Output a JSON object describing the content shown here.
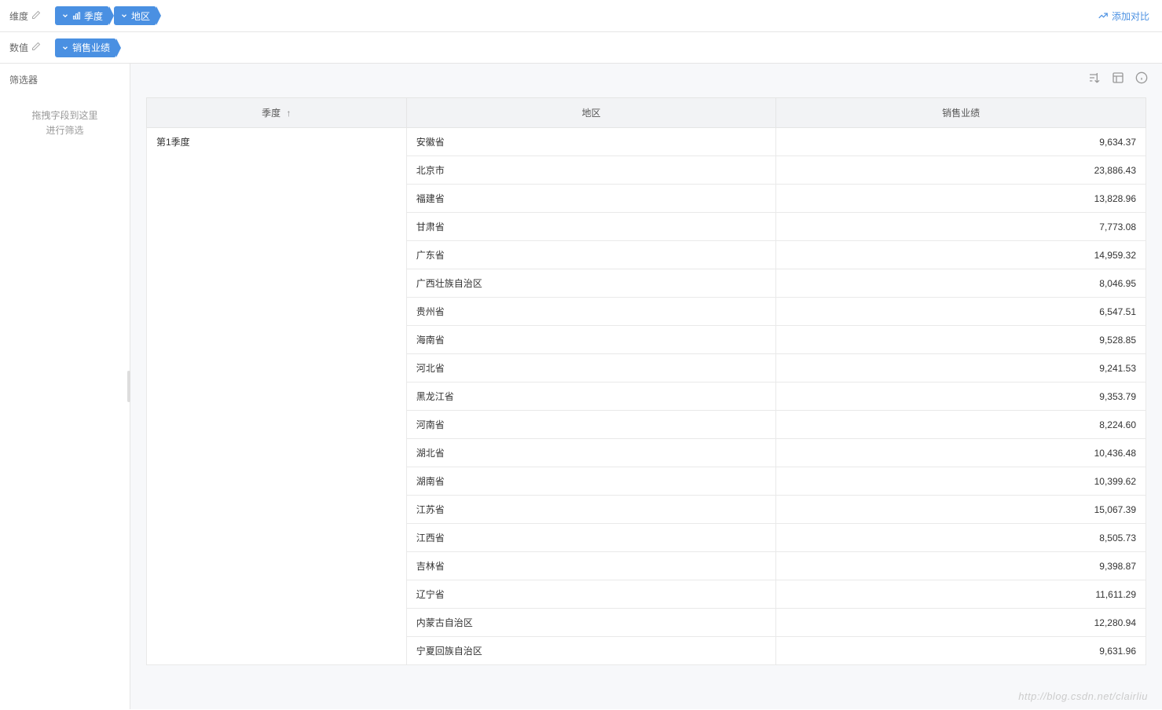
{
  "topbar": {
    "dimension_label": "维度",
    "value_label": "数值",
    "pills_dim": [
      {
        "label": "季度",
        "has_icon": true
      },
      {
        "label": "地区",
        "has_icon": false
      }
    ],
    "pills_val": [
      {
        "label": "销售业绩",
        "has_icon": false
      }
    ],
    "add_compare": "添加对比"
  },
  "sidebar": {
    "filter_title": "筛选器",
    "placeholder_line1": "拖拽字段到这里",
    "placeholder_line2": "进行筛选"
  },
  "table": {
    "headers": {
      "quarter": "季度",
      "region": "地区",
      "value": "销售业绩"
    },
    "quarter_label": "第1季度",
    "rows": [
      {
        "region": "安徽省",
        "value": "9,634.37"
      },
      {
        "region": "北京市",
        "value": "23,886.43"
      },
      {
        "region": "福建省",
        "value": "13,828.96"
      },
      {
        "region": "甘肃省",
        "value": "7,773.08"
      },
      {
        "region": "广东省",
        "value": "14,959.32"
      },
      {
        "region": "广西壮族自治区",
        "value": "8,046.95"
      },
      {
        "region": "贵州省",
        "value": "6,547.51"
      },
      {
        "region": "海南省",
        "value": "9,528.85"
      },
      {
        "region": "河北省",
        "value": "9,241.53"
      },
      {
        "region": "黑龙江省",
        "value": "9,353.79"
      },
      {
        "region": "河南省",
        "value": "8,224.60"
      },
      {
        "region": "湖北省",
        "value": "10,436.48"
      },
      {
        "region": "湖南省",
        "value": "10,399.62"
      },
      {
        "region": "江苏省",
        "value": "15,067.39"
      },
      {
        "region": "江西省",
        "value": "8,505.73"
      },
      {
        "region": "吉林省",
        "value": "9,398.87"
      },
      {
        "region": "辽宁省",
        "value": "11,611.29"
      },
      {
        "region": "内蒙古自治区",
        "value": "12,280.94"
      },
      {
        "region": "宁夏回族自治区",
        "value": "9,631.96"
      }
    ]
  },
  "watermark": "http://blog.csdn.net/clairliu"
}
